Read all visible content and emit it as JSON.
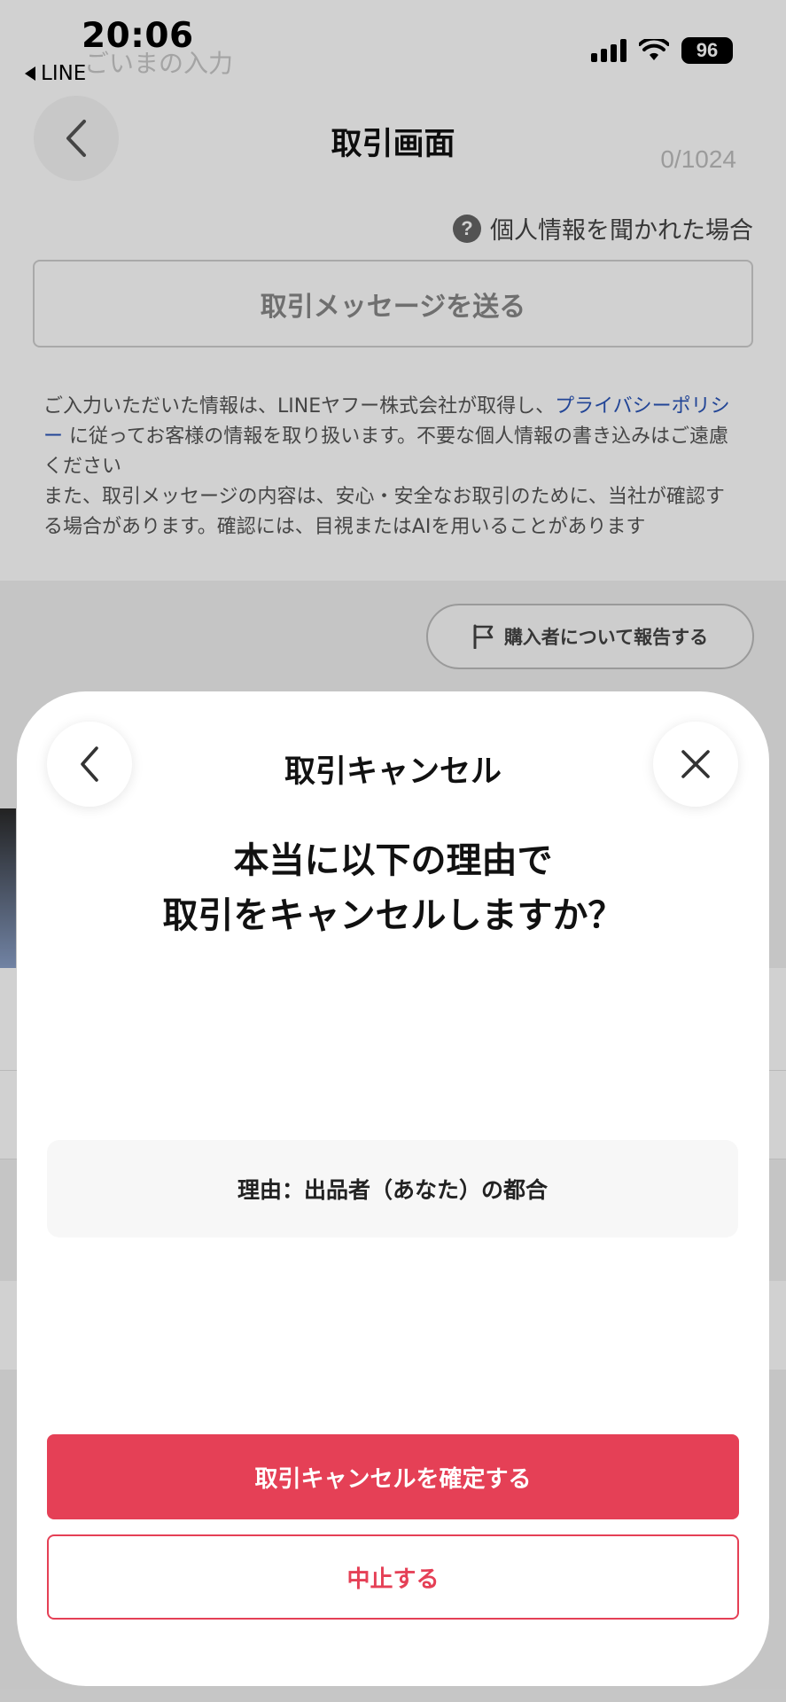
{
  "status_bar": {
    "time": "20:06",
    "back_app": "LINE",
    "battery": "96"
  },
  "background": {
    "faded_text": "ごいまの入力",
    "counter": "0/1024",
    "nav_title": "取引画面",
    "privacy_help": "個人情報を聞かれた場合",
    "send_message_button": "取引メッセージを送る",
    "notice": {
      "part1": "ご入力いただいた情報は、LINEヤフー株式会社が取得し、",
      "link": "プライバシーポリシー",
      "part2": " に従ってお客様の情報を取り扱います。不要な個人情報の書き込みはご遠慮ください",
      "part3": "また、取引メッセージの内容は、安心・安全なお取引のために、当社が確認する場合があります。確認には、目視またはAIを用いることがあります"
    },
    "report_button": "購入者について報告する"
  },
  "sheet": {
    "title": "取引キャンセル",
    "question_line1": "本当に以下の理由で",
    "question_line2": "取引をキャンセルしますか？",
    "reason": "理由：出品者（あなた）の都合",
    "confirm_button": "取引キャンセルを確定する",
    "stop_button": "中止する"
  },
  "colors": {
    "accent": "#e54056",
    "link": "#2a55b8"
  },
  "icons": {
    "back": "chevron-left-icon",
    "close": "close-icon",
    "help": "question-circle-icon",
    "flag": "flag-icon",
    "signal": "signal-icon",
    "wifi": "wifi-icon",
    "battery": "battery-icon"
  }
}
